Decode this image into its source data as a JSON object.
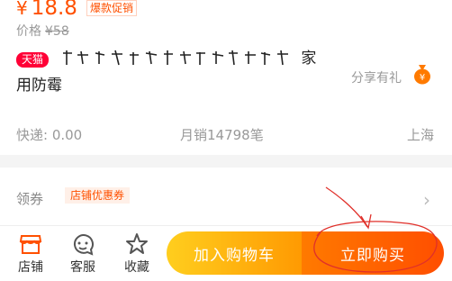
{
  "price": {
    "currency": "¥",
    "value": "18.8",
    "promo": "爆款促销"
  },
  "original": {
    "label": "价格",
    "value": "¥58"
  },
  "title": {
    "badge": "天猫",
    "line1": "家",
    "line2": "用防霉"
  },
  "share": {
    "label": "分享有礼"
  },
  "info": {
    "express": "快递: 0.00",
    "sales": "月销14798笔",
    "location": "上海"
  },
  "coupon": {
    "label": "领券",
    "tag": "店铺优惠券"
  },
  "tabbar": {
    "shop": "店铺",
    "service": "客服",
    "favorite": "收藏"
  },
  "actions": {
    "cart": "加入购物车",
    "buy": "立即购买"
  },
  "colors": {
    "accent": "#ff5000",
    "cart_gradient": [
      "#ffce1e",
      "#ff9a02"
    ],
    "buy_gradient": [
      "#ff7a00",
      "#ff4e00"
    ],
    "annotation": "#e0302a",
    "tmall": "#ff0036"
  },
  "icons": {
    "shop": "store-icon",
    "service": "smiley-icon",
    "favorite": "star-icon",
    "share": "money-bag-icon",
    "chevron": "chevron-right-icon"
  }
}
